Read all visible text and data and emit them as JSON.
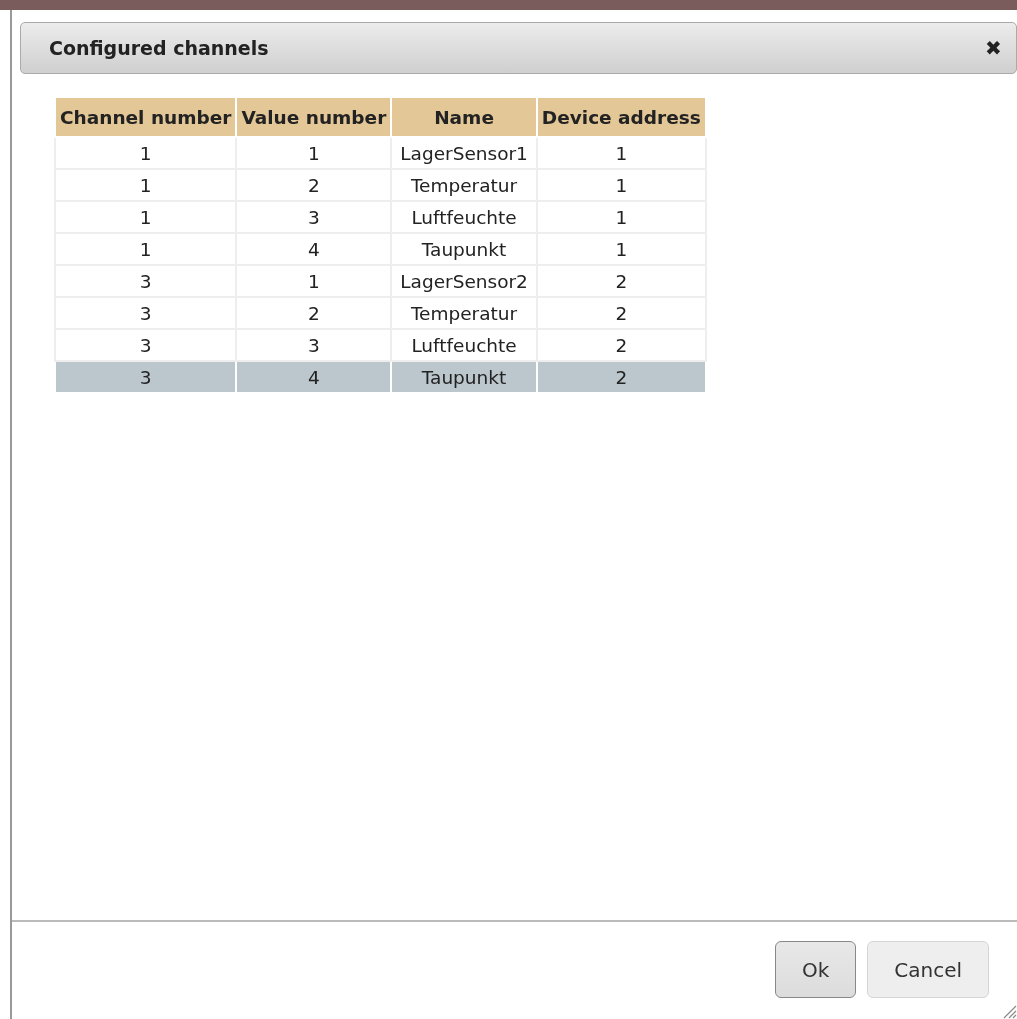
{
  "dialog": {
    "title": "Configured channels",
    "close": "✖"
  },
  "table": {
    "columns": [
      "Channel number",
      "Value number",
      "Name",
      "Device address"
    ],
    "rows": [
      {
        "cells": [
          "1",
          "1",
          "LagerSensor1",
          "1"
        ],
        "selected": false
      },
      {
        "cells": [
          "1",
          "2",
          "Temperatur",
          "1"
        ],
        "selected": false
      },
      {
        "cells": [
          "1",
          "3",
          "Luftfeuchte",
          "1"
        ],
        "selected": false
      },
      {
        "cells": [
          "1",
          "4",
          "Taupunkt",
          "1"
        ],
        "selected": false
      },
      {
        "cells": [
          "3",
          "1",
          "LagerSensor2",
          "2"
        ],
        "selected": false
      },
      {
        "cells": [
          "3",
          "2",
          "Temperatur",
          "2"
        ],
        "selected": false
      },
      {
        "cells": [
          "3",
          "3",
          "Luftfeuchte",
          "2"
        ],
        "selected": false
      },
      {
        "cells": [
          "3",
          "4",
          "Taupunkt",
          "2"
        ],
        "selected": true
      }
    ]
  },
  "buttons": [
    {
      "label": "Ok",
      "focused": true
    },
    {
      "label": "Cancel",
      "focused": false
    }
  ]
}
